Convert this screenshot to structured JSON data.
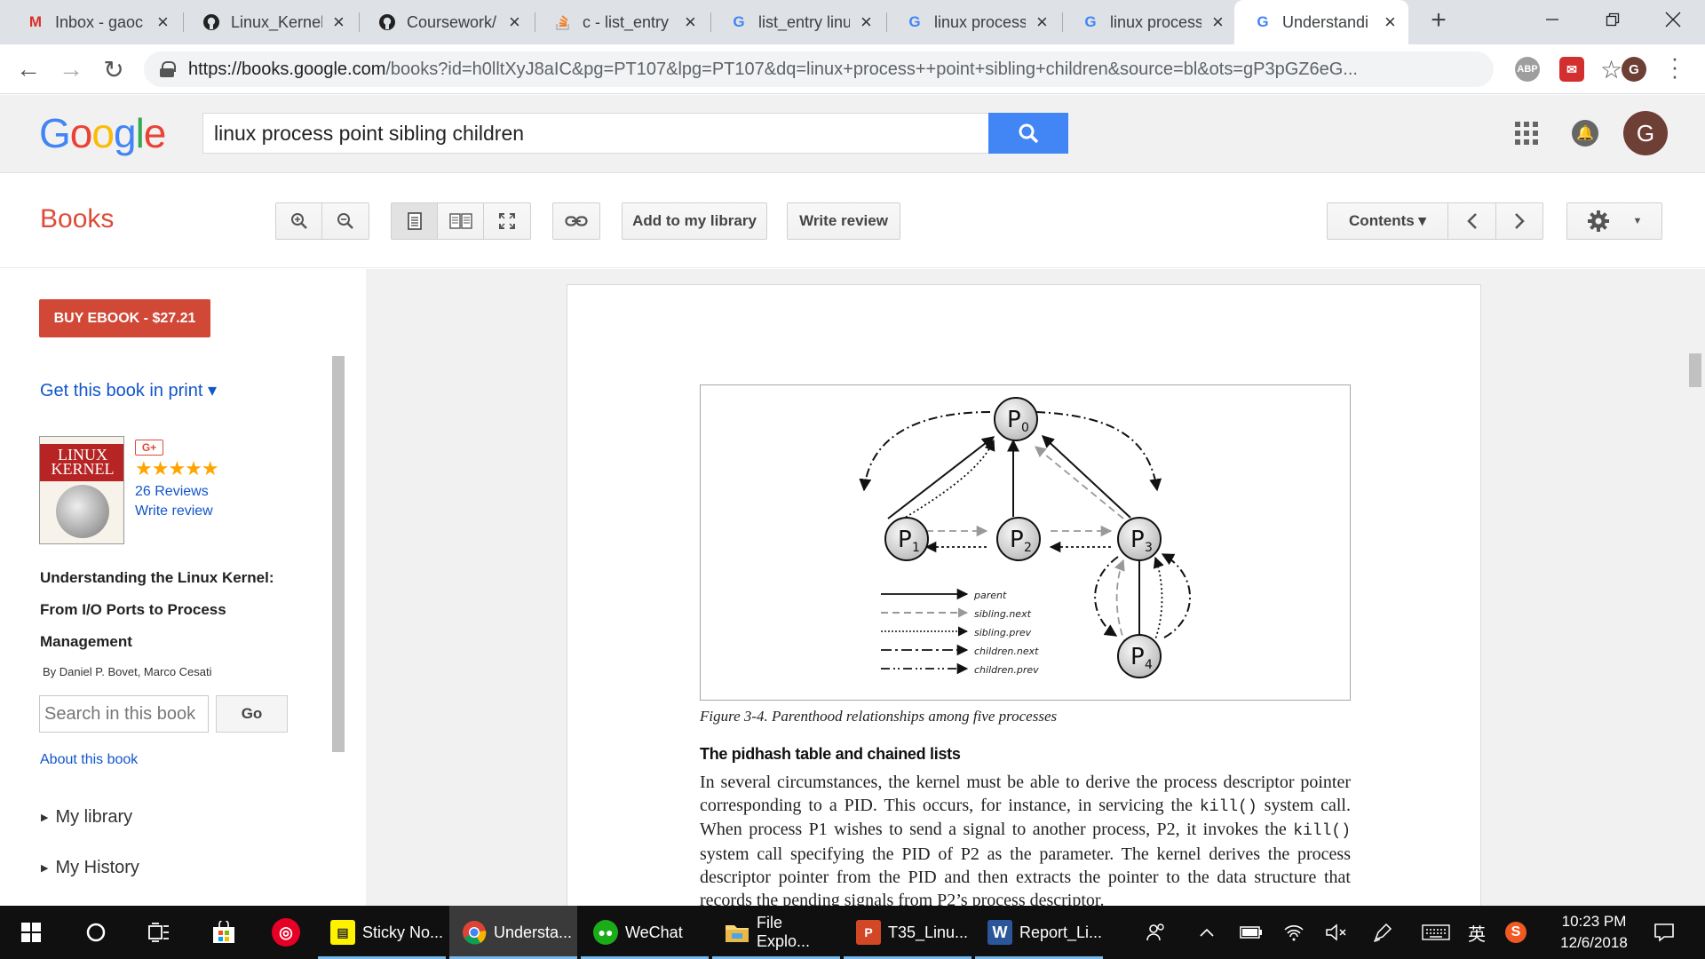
{
  "browser": {
    "tabs": [
      {
        "title": "Inbox - gaoc",
        "icon": "gmail-icon"
      },
      {
        "title": "Linux_Kernel",
        "icon": "github-icon"
      },
      {
        "title": "Coursework/",
        "icon": "github-icon"
      },
      {
        "title": "c - list_entry",
        "icon": "stackoverflow-icon"
      },
      {
        "title": "list_entry linu",
        "icon": "google-icon"
      },
      {
        "title": "linux process",
        "icon": "google-icon"
      },
      {
        "title": "linux process",
        "icon": "google-icon"
      },
      {
        "title": "Understandi",
        "icon": "google-icon",
        "active": true
      }
    ],
    "url_host": "https://books.google.com",
    "url_rest": "/books?id=h0lltXyJ8aIC&pg=PT107&lpg=PT107&dq=linux+process++point+sibling+children&source=bl&ots=gP3pGZ6eG...",
    "extension_abp": "ABP",
    "profile_initial": "G"
  },
  "google": {
    "logo": "Google",
    "search_query": "linux process  point sibling children",
    "avatar_initial": "G"
  },
  "books_bar": {
    "title": "Books",
    "add_library": "Add to my library",
    "write_review": "Write review",
    "contents": "Contents ▾"
  },
  "sidebar": {
    "buy_label": "BUY EBOOK - $27.21",
    "print_link": "Get this book in print ▾",
    "cover_title": "LINUX KERNEL",
    "gplus": "G+",
    "stars": "★★★★★",
    "reviews": "26 Reviews",
    "write_review": "Write review",
    "book_title": "Understanding the Linux Kernel: From I/O Ports to Process Management",
    "authors": "By Daniel P. Bovet, Marco Cesati",
    "search_placeholder": "Search in this book",
    "go": "Go",
    "about": "About this book",
    "my_library": "My library",
    "my_history": "My History"
  },
  "page": {
    "figure_nodes": [
      "0",
      "1",
      "2",
      "3",
      "4"
    ],
    "legend": [
      "parent",
      "sibling.next",
      "sibling.prev",
      "children.next",
      "children.prev"
    ],
    "caption": "Figure 3-4. Parenthood relationships among five processes",
    "heading": "The pidhash table and chained lists",
    "para_1": "In several circumstances, the kernel must be able to derive the process descriptor pointer corresponding to a PID. This occurs, for instance, in servicing the ",
    "code_1": "kill()",
    "para_2": " system call. When process P1 wishes to send a signal to another process, P2, it invokes the ",
    "code_2": "kill()",
    "para_3": " system call specifying the PID of P2 as the parameter. The kernel derives the process descriptor pointer from the PID and then extracts the pointer to the data structure that records the pending signals from P2’s process descriptor."
  },
  "taskbar": {
    "items": [
      "Sticky No...",
      "Understa...",
      "WeChat",
      "File Explo...",
      "T35_Linu...",
      "Report_Li..."
    ],
    "ime": "英",
    "time": "10:23 PM",
    "date": "12/6/2018"
  }
}
